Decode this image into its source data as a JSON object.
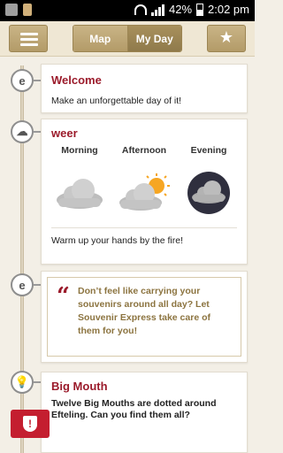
{
  "status_bar": {
    "battery": "42%",
    "time": "2:02 pm"
  },
  "appbar": {
    "tabs": [
      {
        "label": "Map",
        "active": false
      },
      {
        "label": "My Day",
        "active": true
      }
    ],
    "menu_icon": "hamburger-icon",
    "favorite_icon": "star-icon"
  },
  "cards": {
    "welcome": {
      "title": "Welcome",
      "text": "Make an unforgettable day of it!"
    },
    "weather": {
      "title": "weer",
      "periods": [
        {
          "label": "Morning",
          "icon": "cloud-icon"
        },
        {
          "label": "Afternoon",
          "icon": "cloud-sun-icon"
        },
        {
          "label": "Evening",
          "icon": "cloud-moon-icon"
        }
      ],
      "text": "Warm up your hands by the fire!"
    },
    "souvenir": {
      "text": "Don’t feel like carrying your souvenirs around all day? Let Souvenir Express take care of them for you!"
    },
    "bigmouth": {
      "title": "Big Mouth",
      "text": "Twelve Big Mouths are dotted around Efteling. Can you find them all?"
    }
  },
  "colors": {
    "accent": "#9b1b2b",
    "tan": "#b39b68",
    "alert": "#c41e2f"
  }
}
